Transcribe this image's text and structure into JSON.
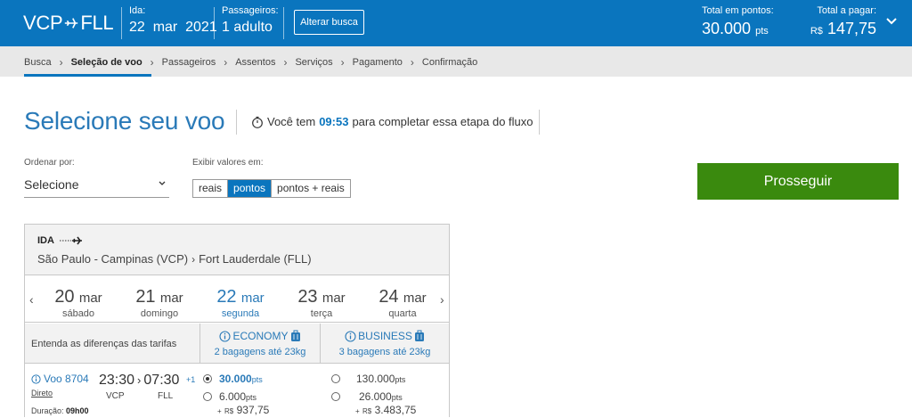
{
  "header": {
    "route": {
      "origin": "VCP",
      "destination": "FLL"
    },
    "ida": {
      "label": "Ida:",
      "value": "22  mar  2021"
    },
    "passengers": {
      "label": "Passageiros:",
      "value": "1 adulto"
    },
    "change_search": "Alterar busca",
    "total_points": {
      "label": "Total em pontos:",
      "value": "30.000",
      "unit": "pts"
    },
    "total_pay": {
      "label": "Total a pagar:",
      "currency": "R$",
      "value": "147,75"
    }
  },
  "breadcrumb": [
    "Busca",
    "Seleção de voo",
    "Passageiros",
    "Assentos",
    "Serviços",
    "Pagamento",
    "Confirmação"
  ],
  "breadcrumb_active": "Seleção de voo",
  "page": {
    "title": "Selecione seu voo",
    "timer_prefix": "Você tem",
    "timer_value": "09:53",
    "timer_suffix": "para completar essa etapa do fluxo"
  },
  "controls": {
    "sort_label": "Ordenar por:",
    "sort_value": "Selecione",
    "view_label": "Exibir valores em:",
    "view_options": [
      "reais",
      "pontos",
      "pontos + reais"
    ],
    "view_selected": "pontos",
    "proceed": "Prosseguir"
  },
  "card": {
    "direction": "IDA",
    "origin": "São Paulo - Campinas (VCP)",
    "destination": "Fort Lauderdale (FLL)",
    "dates": [
      {
        "day": "20",
        "month": "mar",
        "weekday": "sábado"
      },
      {
        "day": "21",
        "month": "mar",
        "weekday": "domingo"
      },
      {
        "day": "22",
        "month": "mar",
        "weekday": "segunda"
      },
      {
        "day": "23",
        "month": "mar",
        "weekday": "terça"
      },
      {
        "day": "24",
        "month": "mar",
        "weekday": "quarta"
      }
    ],
    "selected_date": "22 mar",
    "fares_explain": "Entenda as diferenças das tarifas",
    "fares": [
      {
        "name": "ECONOMY",
        "baggage": "2 bagagens até 23kg"
      },
      {
        "name": "BUSINESS",
        "baggage": "3 bagagens até 23kg"
      }
    ],
    "flight": {
      "number": "Voo 8704",
      "type": "Direto",
      "duration_label": "Duração:",
      "duration": "09h00",
      "dep_time": "23:30",
      "arr_time": "07:30",
      "day_offset": "+1",
      "dep_airport": "VCP",
      "arr_airport": "FLL",
      "economy": {
        "opt1_pts": "30.000",
        "opt1_unit": "pts",
        "opt2_pts": "6.000",
        "opt2_unit": "pts",
        "opt2_money_prefix": "+",
        "opt2_currency": "R$",
        "opt2_money": "937,75"
      },
      "business": {
        "opt1_pts": "130.000",
        "opt1_unit": "pts",
        "opt2_pts": "26.000",
        "opt2_unit": "pts",
        "opt2_money_prefix": "+",
        "opt2_currency": "R$",
        "opt2_money": "3.483,75"
      }
    }
  },
  "colors": {
    "brand_blue": "#0a75be",
    "title_blue": "#2a7ab8",
    "proceed_green": "#3a8a0e"
  }
}
